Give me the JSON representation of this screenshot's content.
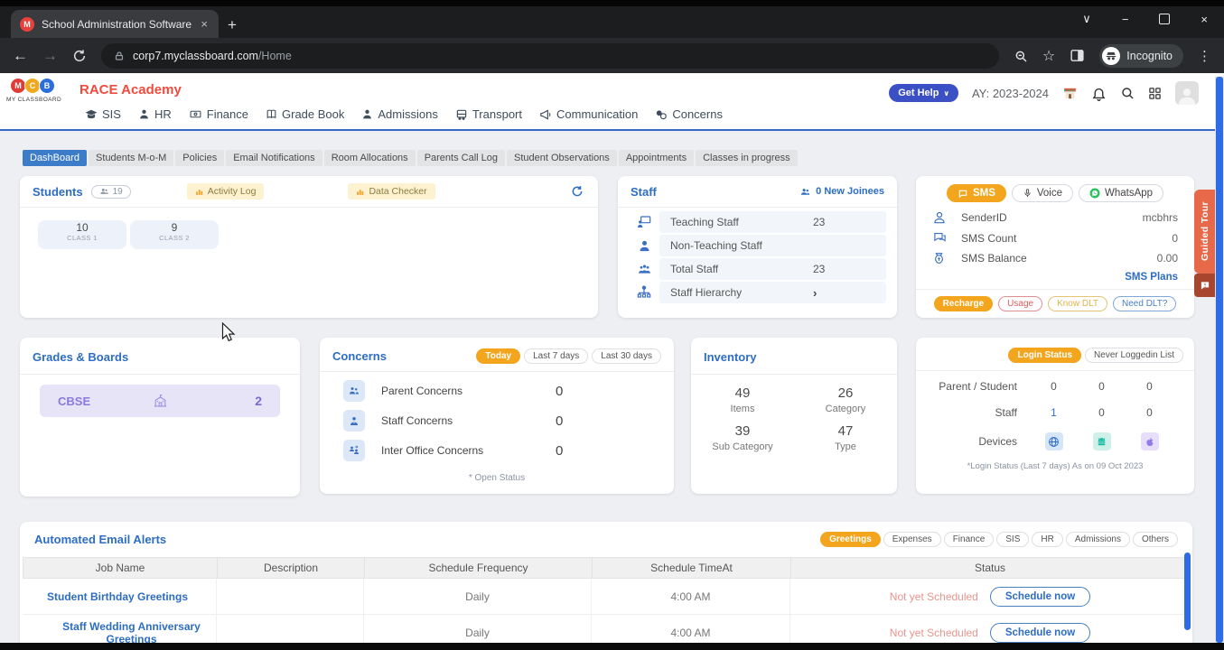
{
  "colors": {
    "accent_blue": "#2d6dc3",
    "active_tab_blue": "#3d7cc9",
    "orange": "#f2a51d",
    "brand_red": "#f14b3e",
    "guided_tour_orange": "#e8684a",
    "status_salmon": "#e8958c",
    "scrollbar_blue": "#2e6be6",
    "purple": "#8a7ae0"
  },
  "icons": {
    "back": "←",
    "forward": "→",
    "close": "×",
    "minimize": "−",
    "new_tab": "+",
    "chevron_down": "∨",
    "kebab": "⋮",
    "star": "☆",
    "chevron_right": "›"
  },
  "browser": {
    "tab_title": "School Administration Software",
    "url_host": "corp7.myclassboard.com",
    "url_path": "/Home",
    "incognito_label": "Incognito"
  },
  "header": {
    "logo_letters": [
      "M",
      "C",
      "B"
    ],
    "logo_caption": "MY CLASSBOARD",
    "school_name": "RACE Academy",
    "nav": [
      {
        "label": "SIS"
      },
      {
        "label": "HR"
      },
      {
        "label": "Finance"
      },
      {
        "label": "Grade Book"
      },
      {
        "label": "Admissions"
      },
      {
        "label": "Transport"
      },
      {
        "label": "Communication"
      },
      {
        "label": "Concerns"
      }
    ],
    "get_help_label": "Get Help",
    "academic_year": "AY: 2023-2024"
  },
  "tabs": {
    "items": [
      {
        "label": "DashBoard"
      },
      {
        "label": "Students M-o-M"
      },
      {
        "label": "Policies"
      },
      {
        "label": "Email Notifications"
      },
      {
        "label": "Room Allocations"
      },
      {
        "label": "Parents Call Log"
      },
      {
        "label": "Student Observations"
      },
      {
        "label": "Appointments"
      },
      {
        "label": "Classes in progress"
      }
    ]
  },
  "students": {
    "title": "Students",
    "count": "19",
    "activity_log": "Activity Log",
    "data_checker": "Data Checker",
    "classes": [
      {
        "value": "10",
        "label": "CLASS 1"
      },
      {
        "value": "9",
        "label": "CLASS 2"
      }
    ]
  },
  "staff": {
    "title": "Staff",
    "new_joinees": "0 New Joinees",
    "rows": [
      {
        "label": "Teaching Staff",
        "value": "23"
      },
      {
        "label": "Non-Teaching Staff",
        "value": ""
      },
      {
        "label": "Total Staff",
        "value": "23"
      },
      {
        "label": "Staff Hierarchy",
        "value": ""
      }
    ]
  },
  "sms": {
    "tabs": [
      {
        "label": "SMS"
      },
      {
        "label": "Voice"
      },
      {
        "label": "WhatsApp"
      }
    ],
    "rows": [
      {
        "label": "SenderID",
        "value": "mcbhrs"
      },
      {
        "label": "SMS Count",
        "value": "0"
      },
      {
        "label": "SMS Balance",
        "value": "0.00"
      }
    ],
    "plans_link": "SMS Plans",
    "buttons": [
      {
        "label": "Recharge"
      },
      {
        "label": "Usage"
      },
      {
        "label": "Know DLT"
      },
      {
        "label": "Need DLT?"
      }
    ]
  },
  "grades": {
    "title": "Grades & Boards",
    "board": "CBSE",
    "count": "2"
  },
  "concerns": {
    "title": "Concerns",
    "filters": [
      {
        "label": "Today"
      },
      {
        "label": "Last 7 days"
      },
      {
        "label": "Last 30 days"
      }
    ],
    "rows": [
      {
        "label": "Parent Concerns",
        "value": "0"
      },
      {
        "label": "Staff Concerns",
        "value": "0"
      },
      {
        "label": "Inter Office Concerns",
        "value": "0"
      }
    ],
    "footnote": "* Open Status"
  },
  "inventory": {
    "title": "Inventory",
    "stats": [
      {
        "value": "49",
        "label": "Items"
      },
      {
        "value": "26",
        "label": "Category"
      },
      {
        "value": "39",
        "label": "Sub Category"
      },
      {
        "value": "47",
        "label": "Type"
      }
    ]
  },
  "login": {
    "tabs": [
      {
        "label": "Login Status"
      },
      {
        "label": "Never Loggedin List"
      }
    ],
    "rows": [
      {
        "label": "Parent / Student",
        "values": [
          "0",
          "0",
          "0"
        ]
      },
      {
        "label": "Staff",
        "values": [
          "1",
          "0",
          "0"
        ]
      }
    ],
    "devices_label": "Devices",
    "footnote": "*Login Status (Last 7 days) As on 09 Oct 2023"
  },
  "email_alerts": {
    "title": "Automated Email Alerts",
    "filters": [
      {
        "label": "Greetings"
      },
      {
        "label": "Expenses"
      },
      {
        "label": "Finance"
      },
      {
        "label": "SIS"
      },
      {
        "label": "HR"
      },
      {
        "label": "Admissions"
      },
      {
        "label": "Others"
      }
    ],
    "columns": [
      "Job Name",
      "Description",
      "Schedule Frequency",
      "Schedule TimeAt",
      "Status"
    ],
    "rows": [
      {
        "job": "Student Birthday Greetings",
        "description": "",
        "frequency": "Daily",
        "time": "4:00 AM",
        "status": "Not yet Scheduled",
        "action": "Schedule now"
      },
      {
        "job": "Staff Wedding Anniversary Greetings",
        "description": "",
        "frequency": "Daily",
        "time": "4:00 AM",
        "status": "Not yet Scheduled",
        "action": "Schedule now"
      }
    ]
  },
  "guided_tour_label": "Guided Tour"
}
